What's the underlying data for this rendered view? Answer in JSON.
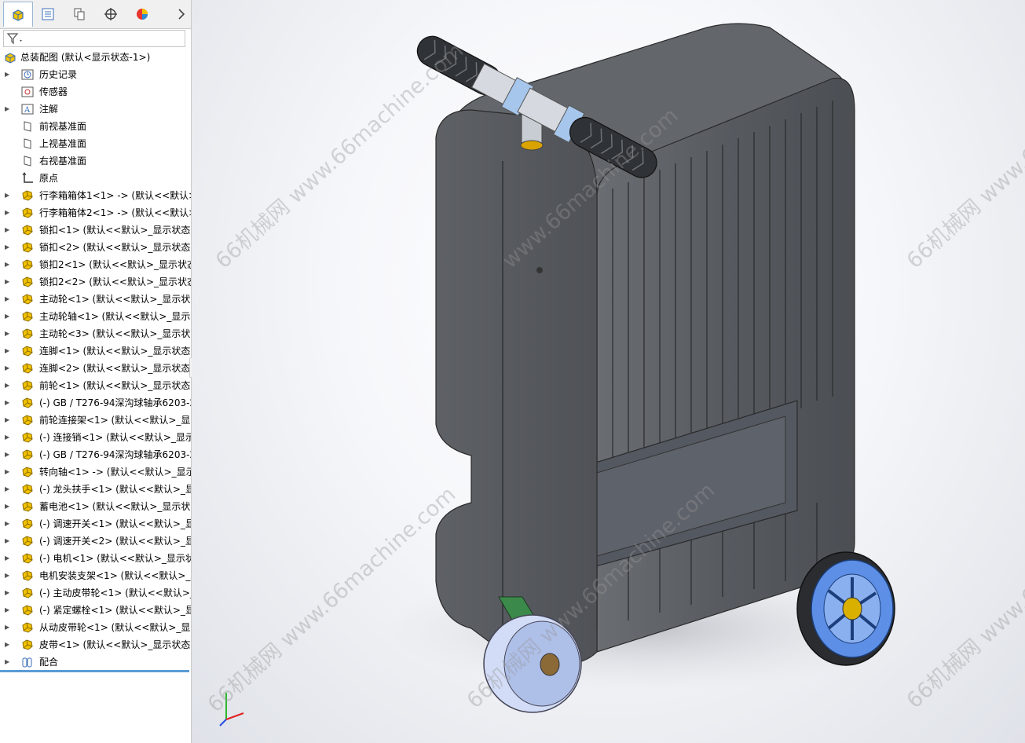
{
  "colors": {
    "accent": "#5b9bd5",
    "panel_bg": "#ffffff",
    "tab_bg": "#f0f0f0",
    "part_icon": "#f2c200",
    "suitcase_body": "#5a5d61",
    "wheel_blue": "#5d8fe6"
  },
  "tabs": [
    {
      "icon": "feature-manager-icon",
      "active": true
    },
    {
      "icon": "property-manager-icon"
    },
    {
      "icon": "configuration-manager-icon"
    },
    {
      "icon": "dimxpert-icon"
    },
    {
      "icon": "display-manager-icon"
    },
    {
      "icon": "chevron-right-icon"
    }
  ],
  "filter": {
    "icon": "filter-icon"
  },
  "tree": {
    "root": "总装配图 (默认<显示状态-1>)",
    "items": [
      {
        "label": "历史记录",
        "icon": "history-icon",
        "expand": true
      },
      {
        "label": "传感器",
        "icon": "sensor-icon",
        "expand": false
      },
      {
        "label": "注解",
        "icon": "annotation-icon",
        "expand": true
      },
      {
        "label": "前视基准面",
        "icon": "plane-icon",
        "expand": false
      },
      {
        "label": "上视基准面",
        "icon": "plane-icon",
        "expand": false
      },
      {
        "label": "右视基准面",
        "icon": "plane-icon",
        "expand": false
      },
      {
        "label": "原点",
        "icon": "origin-icon",
        "expand": false
      },
      {
        "label": "行李箱箱体1<1> -> (默认<<默认>",
        "icon": "part-icon",
        "expand": true
      },
      {
        "label": "行李箱箱体2<1> -> (默认<<默认>",
        "icon": "part-icon",
        "expand": true
      },
      {
        "label": "锁扣<1> (默认<<默认>_显示状态",
        "icon": "part-icon",
        "expand": true
      },
      {
        "label": "锁扣<2> (默认<<默认>_显示状态",
        "icon": "part-icon",
        "expand": true
      },
      {
        "label": "锁扣2<1> (默认<<默认>_显示状态",
        "icon": "part-icon",
        "expand": true
      },
      {
        "label": "锁扣2<2> (默认<<默认>_显示状态",
        "icon": "part-icon",
        "expand": true
      },
      {
        "label": "主动轮<1> (默认<<默认>_显示状态",
        "icon": "part-icon",
        "expand": true
      },
      {
        "label": "主动轮轴<1> (默认<<默认>_显示状态",
        "icon": "part-icon",
        "expand": true
      },
      {
        "label": "主动轮<3> (默认<<默认>_显示状态",
        "icon": "part-icon",
        "expand": true
      },
      {
        "label": "连脚<1> (默认<<默认>_显示状态",
        "icon": "part-icon",
        "expand": true
      },
      {
        "label": "连脚<2> (默认<<默认>_显示状态",
        "icon": "part-icon",
        "expand": true
      },
      {
        "label": "前轮<1> (默认<<默认>_显示状态",
        "icon": "part-icon",
        "expand": true
      },
      {
        "label": "(-) GB / T276-94深沟球轴承6203-2",
        "icon": "part-icon",
        "expand": true
      },
      {
        "label": "前轮连接架<1> (默认<<默认>_显示",
        "icon": "part-icon",
        "expand": true
      },
      {
        "label": "(-) 连接销<1> (默认<<默认>_显示",
        "icon": "part-icon",
        "expand": true
      },
      {
        "label": "(-) GB / T276-94深沟球轴承6203-2",
        "icon": "part-icon",
        "expand": true
      },
      {
        "label": "转向轴<1> -> (默认<<默认>_显示",
        "icon": "part-icon",
        "expand": true
      },
      {
        "label": "(-) 龙头扶手<1> (默认<<默认>_显",
        "icon": "part-icon",
        "expand": true
      },
      {
        "label": "蓄电池<1> (默认<<默认>_显示状态",
        "icon": "part-icon",
        "expand": true
      },
      {
        "label": "(-) 调速开关<1> (默认<<默认>_显",
        "icon": "part-icon",
        "expand": true
      },
      {
        "label": "(-) 调速开关<2> (默认<<默认>_显",
        "icon": "part-icon",
        "expand": true
      },
      {
        "label": "(-) 电机<1> (默认<<默认>_显示状",
        "icon": "part-icon",
        "expand": true
      },
      {
        "label": "电机安装支架<1> (默认<<默认>_显",
        "icon": "part-icon",
        "expand": true
      },
      {
        "label": "(-) 主动皮带轮<1> (默认<<默认>_",
        "icon": "part-icon",
        "expand": true
      },
      {
        "label": "(-) 紧定螺栓<1> (默认<<默认>_显",
        "icon": "part-icon",
        "expand": true
      },
      {
        "label": "从动皮带轮<1> (默认<<默认>_显示",
        "icon": "part-icon",
        "expand": true
      },
      {
        "label": "皮带<1> (默认<<默认>_显示状态",
        "icon": "part-icon",
        "expand": true
      },
      {
        "label": "配合",
        "icon": "mates-icon",
        "expand": true
      }
    ]
  },
  "viewport": {
    "triad_axes": [
      "x-axis",
      "y-axis",
      "z-axis"
    ]
  },
  "watermarks": {
    "site": "www.66machine.com",
    "brand": "66机械网",
    "brand_site": "66机械网 www.66machine.com"
  }
}
